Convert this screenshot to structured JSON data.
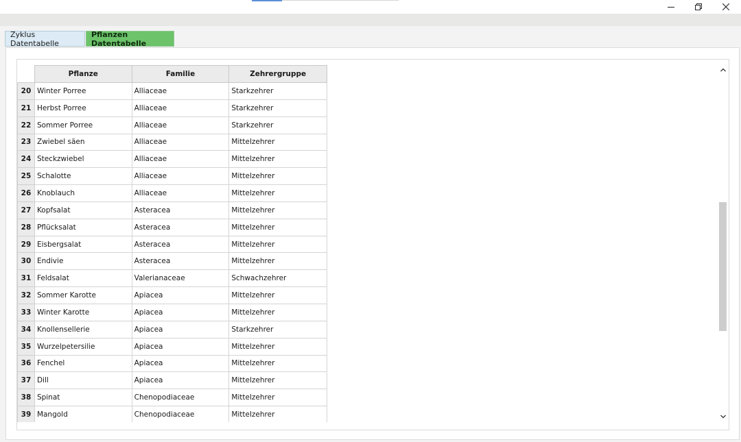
{
  "tabs": [
    {
      "label": "Zyklus Datentabelle",
      "active": false
    },
    {
      "label": "Pflanzen Datentabelle",
      "active": true
    }
  ],
  "icons": {
    "minimize": "minimize-icon",
    "maximize": "restore-icon",
    "close": "close-icon",
    "scroll_up": "chevron-up-icon",
    "scroll_down": "chevron-down-icon"
  },
  "colors": {
    "active_tab": "#6cc36a",
    "inactive_tab": "#dcebf5",
    "header_bg": "#ebebeb"
  },
  "table": {
    "columns": [
      "Pflanze",
      "Familie",
      "Zehrergruppe"
    ],
    "rows": [
      {
        "num": "20",
        "pflanze": "Winter Porree",
        "familie": "Alliaceae",
        "zehrergruppe": "Starkzehrer"
      },
      {
        "num": "21",
        "pflanze": "Herbst Porree",
        "familie": "Alliaceae",
        "zehrergruppe": "Starkzehrer"
      },
      {
        "num": "22",
        "pflanze": "Sommer Porree",
        "familie": "Alliaceae",
        "zehrergruppe": "Starkzehrer"
      },
      {
        "num": "23",
        "pflanze": "Zwiebel säen",
        "familie": "Alliaceae",
        "zehrergruppe": "Mittelzehrer"
      },
      {
        "num": "24",
        "pflanze": "Steckzwiebel",
        "familie": "Alliaceae",
        "zehrergruppe": "Mittelzehrer"
      },
      {
        "num": "25",
        "pflanze": "Schalotte",
        "familie": "Alliaceae",
        "zehrergruppe": "Mittelzehrer"
      },
      {
        "num": "26",
        "pflanze": "Knoblauch",
        "familie": "Alliaceae",
        "zehrergruppe": "Mittelzehrer"
      },
      {
        "num": "27",
        "pflanze": "Kopfsalat",
        "familie": "Asteracea",
        "zehrergruppe": "Mittelzehrer"
      },
      {
        "num": "28",
        "pflanze": "Pflücksalat",
        "familie": "Asteracea",
        "zehrergruppe": "Mittelzehrer"
      },
      {
        "num": "29",
        "pflanze": "Eisbergsalat",
        "familie": "Asteracea",
        "zehrergruppe": "Mittelzehrer"
      },
      {
        "num": "30",
        "pflanze": "Endivie",
        "familie": "Asteracea",
        "zehrergruppe": "Mittelzehrer"
      },
      {
        "num": "31",
        "pflanze": "Feldsalat",
        "familie": "Valerianaceae",
        "zehrergruppe": "Schwachzehrer"
      },
      {
        "num": "32",
        "pflanze": "Sommer Karotte",
        "familie": "Apiacea",
        "zehrergruppe": "Mittelzehrer"
      },
      {
        "num": "33",
        "pflanze": "Winter Karotte",
        "familie": "Apiacea",
        "zehrergruppe": "Mittelzehrer"
      },
      {
        "num": "34",
        "pflanze": "Knollensellerie",
        "familie": "Apiacea",
        "zehrergruppe": "Starkzehrer"
      },
      {
        "num": "35",
        "pflanze": "Wurzelpetersilie",
        "familie": "Apiacea",
        "zehrergruppe": "Mittelzehrer"
      },
      {
        "num": "36",
        "pflanze": "Fenchel",
        "familie": "Apiacea",
        "zehrergruppe": "Mittelzehrer"
      },
      {
        "num": "37",
        "pflanze": "Dill",
        "familie": "Apiacea",
        "zehrergruppe": "Mittelzehrer"
      },
      {
        "num": "38",
        "pflanze": "Spinat",
        "familie": "Chenopodiaceae",
        "zehrergruppe": "Mittelzehrer"
      },
      {
        "num": "39",
        "pflanze": "Mangold",
        "familie": "Chenopodiaceae",
        "zehrergruppe": "Mittelzehrer"
      }
    ]
  }
}
